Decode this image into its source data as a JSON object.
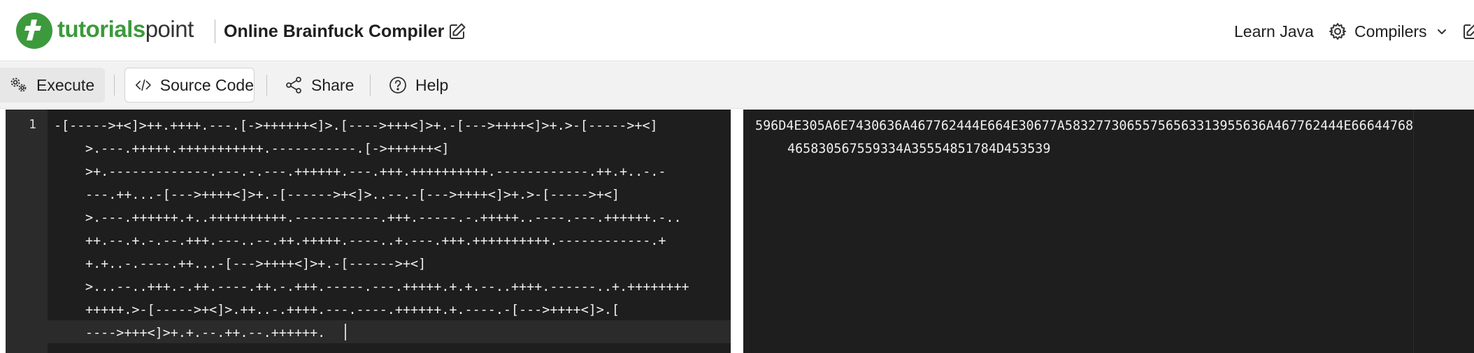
{
  "header": {
    "brand_part1": "tutorials",
    "brand_part2": "point",
    "page_title": "Online Brainfuck Compiler",
    "learn_java": "Learn Java",
    "compilers_label": "Compilers"
  },
  "toolbar": {
    "execute_label": "Execute",
    "source_code_label": "Source Code",
    "share_label": "Share",
    "help_label": "Help"
  },
  "editor": {
    "line_number": "1",
    "lines": [
      "-[----->+<]>++.++++.---.[->++++++<]>.[---->+++<]>+.-[--->++++<]>+.>-[----->+<]",
      ">.---.+++++.+++++++++++.-----------.[->++++++<]",
      ">+.-------------.---.-.---.++++++.---.+++.++++++++++.------------.++.+..-.-",
      "---.++...-[--->++++<]>+.-[------>+<]>..--.-[--->++++<]>+.>-[----->+<]",
      ">.---.++++++.+..++++++++++.-----------.+++.-----.-.+++++..----.---.++++++.-..",
      "++.--.+.-.--.+++.---..--.++.+++++.----..+.---.+++.++++++++++.------------.+",
      "+.+..-.----.++...-[--->++++<]>+.-[------>+<]",
      ">...--..+++.-.++.----.++.-.+++.-----.---.+++++.+.+.--..++++.------..+.++++++++",
      "+++++.>-[----->+<]>.++..-.++++.---.----.++++++.+.----.-[--->++++<]>.[",
      "---->+++<]>+.+.--.++.--.++++++."
    ]
  },
  "output": {
    "lines": [
      "596D4E305A6E7430636A467762444E664E30677A58327730655756563313955636A467762444E66644768",
      "465830567559334A35554851784D453539"
    ]
  },
  "colors": {
    "brand_green": "#3c9a3c",
    "editor_bg": "#1e1e1e",
    "gutter_bg": "#2b2b2b"
  }
}
